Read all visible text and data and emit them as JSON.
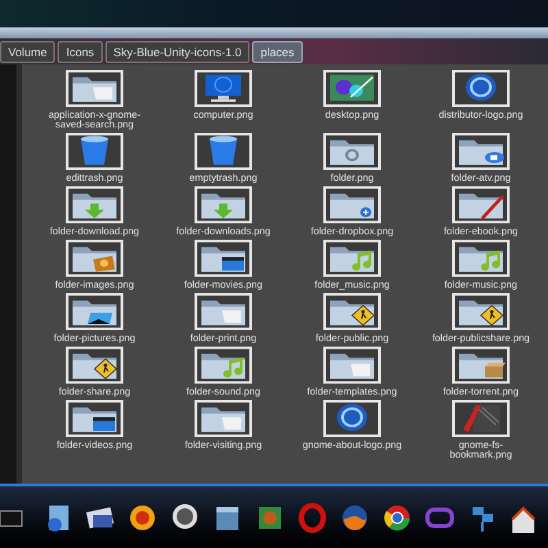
{
  "path_bar": [
    {
      "label": "Volume",
      "selected": false
    },
    {
      "label": "Icons",
      "selected": false
    },
    {
      "label": "Sky-Blue-Unity-icons-1.0",
      "selected": false
    },
    {
      "label": "places",
      "selected": true
    }
  ],
  "files": [
    {
      "name": "application-x-gnome-saved-search.png"
    },
    {
      "name": "computer.png"
    },
    {
      "name": "desktop.png"
    },
    {
      "name": "distributor-logo.png"
    },
    {
      "name": "edittrash.png"
    },
    {
      "name": "emptytrash.png"
    },
    {
      "name": "folder.png"
    },
    {
      "name": "folder-atv.png"
    },
    {
      "name": "folder-download.png"
    },
    {
      "name": "folder-downloads.png"
    },
    {
      "name": "folder-dropbox.png"
    },
    {
      "name": "folder-ebook.png"
    },
    {
      "name": "folder-images.png"
    },
    {
      "name": "folder-movies.png"
    },
    {
      "name": "folder_music.png"
    },
    {
      "name": "folder-music.png"
    },
    {
      "name": "folder-pictures.png"
    },
    {
      "name": "folder-print.png"
    },
    {
      "name": "folder-public.png"
    },
    {
      "name": "folder-publicshare.png"
    },
    {
      "name": "folder-share.png"
    },
    {
      "name": "folder-sound.png"
    },
    {
      "name": "folder-templates.png"
    },
    {
      "name": "folder-torrent.png"
    },
    {
      "name": "folder-videos.png"
    },
    {
      "name": "folder-visiting.png"
    },
    {
      "name": "gnome-about-logo.png"
    },
    {
      "name": "gnome-fs-bookmark.png"
    }
  ]
}
